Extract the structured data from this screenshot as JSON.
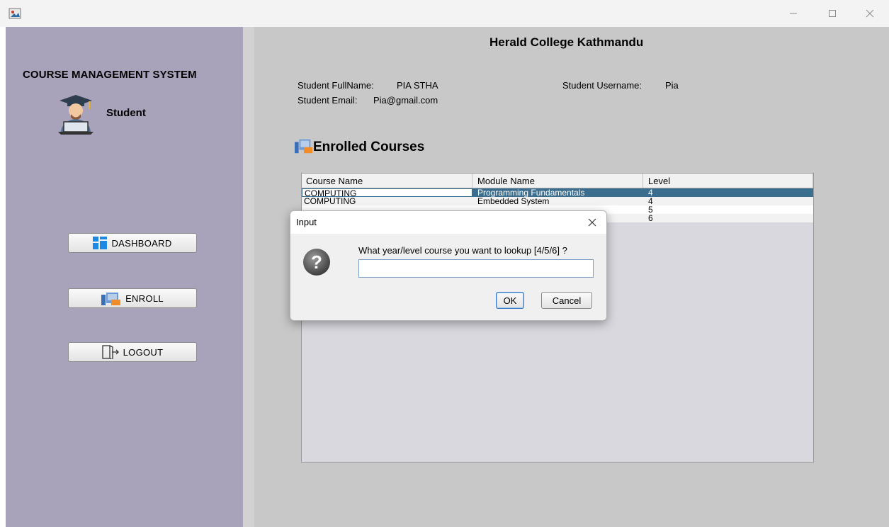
{
  "sidebar": {
    "title": "COURSE MANAGEMENT SYSTEM",
    "role": "Student",
    "buttons": {
      "dashboard": "DASHBOARD",
      "enroll": "ENROLL",
      "logout": "LOGOUT"
    }
  },
  "header": {
    "college": "Herald College Kathmandu",
    "fullname_label": "Student FullName:",
    "fullname_value": "PIA STHA",
    "username_label": "Student Username:",
    "username_value": "Pia",
    "email_label": "Student Email:",
    "email_value": "Pia@gmail.com"
  },
  "courses": {
    "title": "Enrolled Courses",
    "columns": [
      "Course Name",
      "Module Name",
      "Level"
    ],
    "rows": [
      [
        "COMPUTING",
        "Programming Fundamentals",
        "4"
      ],
      [
        "COMPUTING",
        "Embedded System",
        "4"
      ],
      [
        "",
        "",
        "5"
      ],
      [
        "",
        "",
        "6"
      ]
    ]
  },
  "dialog": {
    "title": "Input",
    "message": "What year/level course you want to lookup [4/5/6] ?",
    "input_value": "",
    "ok_label": "OK",
    "cancel_label": "Cancel"
  },
  "colors": {
    "sidebar": "#a8a2ba",
    "main_bg": "#c8c8c8",
    "selection": "#3b6d8f"
  }
}
